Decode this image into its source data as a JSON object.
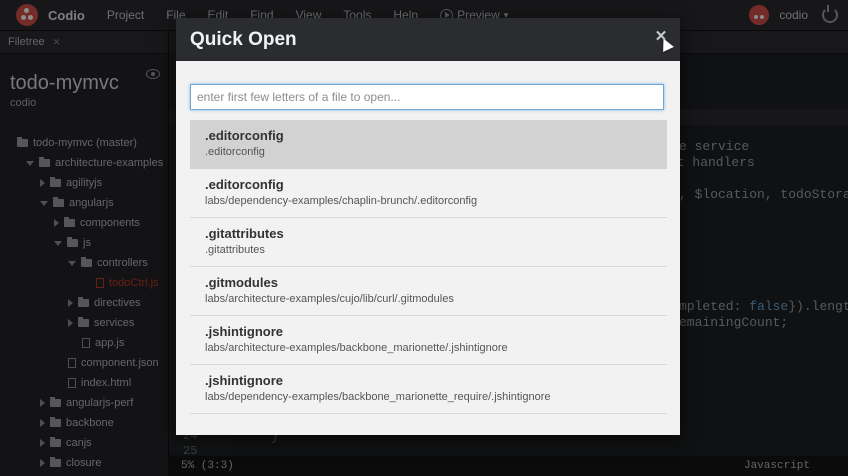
{
  "topbar": {
    "brand": "Codio",
    "menus": [
      "Project",
      "File",
      "Edit",
      "Find",
      "View",
      "Tools",
      "Help"
    ],
    "preview_label": "Preview",
    "username": "codio"
  },
  "sidebar": {
    "tab_label": "Filetree",
    "project_name": "todo-mymvc",
    "project_owner": "codio",
    "tree": [
      {
        "label": "todo-mymvc (master)",
        "depth": 0,
        "kind": "folder",
        "arrow": "none"
      },
      {
        "label": "architecture-examples",
        "depth": 1,
        "kind": "folder",
        "arrow": "down"
      },
      {
        "label": "agilityjs",
        "depth": 2,
        "kind": "folder",
        "arrow": "right"
      },
      {
        "label": "angularjs",
        "depth": 2,
        "kind": "folder",
        "arrow": "down"
      },
      {
        "label": "components",
        "depth": 3,
        "kind": "folder",
        "arrow": "right"
      },
      {
        "label": "js",
        "depth": 3,
        "kind": "folder",
        "arrow": "down"
      },
      {
        "label": "controllers",
        "depth": 4,
        "kind": "folder",
        "arrow": "down"
      },
      {
        "label": "todoCtrl.js",
        "depth": 5,
        "kind": "file",
        "arrow": "none",
        "active": true
      },
      {
        "label": "directives",
        "depth": 4,
        "kind": "folder",
        "arrow": "right"
      },
      {
        "label": "services",
        "depth": 4,
        "kind": "folder",
        "arrow": "right"
      },
      {
        "label": "app.js",
        "depth": 4,
        "kind": "file",
        "arrow": "none"
      },
      {
        "label": "component.json",
        "depth": 3,
        "kind": "file",
        "arrow": "none"
      },
      {
        "label": "index.html",
        "depth": 3,
        "kind": "file",
        "arrow": "none"
      },
      {
        "label": "angularjs-perf",
        "depth": 2,
        "kind": "folder",
        "arrow": "right"
      },
      {
        "label": "backbone",
        "depth": 2,
        "kind": "folder",
        "arrow": "right"
      },
      {
        "label": "canjs",
        "depth": 2,
        "kind": "folder",
        "arrow": "right"
      },
      {
        "label": "closure",
        "depth": 2,
        "kind": "folder",
        "arrow": "right"
      }
    ]
  },
  "editor": {
    "code_fragments": {
      "service": "e service",
      "handlers": "nt handlers",
      "location": ", $location, todoStora",
      "completed_pre": "mpleted: ",
      "completed_kw": "false",
      "completed_post": "}).lengt",
      "remaining": "emainingCount;"
    },
    "line_numbers": [
      "24",
      "25"
    ],
    "status_left": "5% (3:3)",
    "status_right": "Javascript"
  },
  "modal": {
    "title": "Quick Open",
    "close_symbol": "✕",
    "search": {
      "value": "",
      "placeholder": "enter first few letters of a file to open..."
    },
    "results": [
      {
        "name": ".editorconfig",
        "path": ".editorconfig",
        "selected": true
      },
      {
        "name": ".editorconfig",
        "path": "labs/dependency-examples/chaplin-brunch/.editorconfig"
      },
      {
        "name": ".gitattributes",
        "path": ".gitattributes"
      },
      {
        "name": ".gitmodules",
        "path": "labs/architecture-examples/cujo/lib/curl/.gitmodules"
      },
      {
        "name": ".jshintignore",
        "path": "labs/architecture-examples/backbone_marionette/.jshintignore"
      },
      {
        "name": ".jshintignore",
        "path": "labs/dependency-examples/backbone_marionette_require/.jshintignore"
      }
    ]
  }
}
